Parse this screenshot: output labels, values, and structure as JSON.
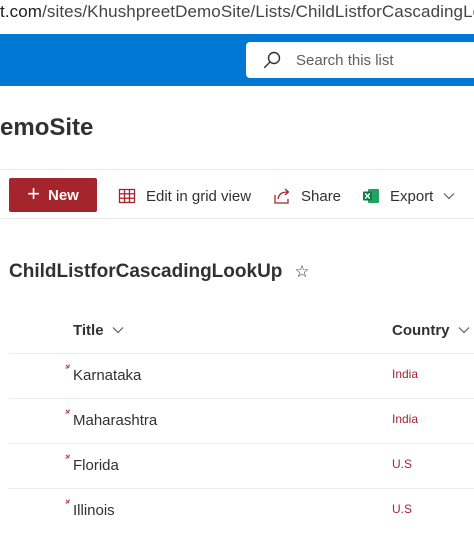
{
  "browser": {
    "url_domain": "t.com",
    "url_path": "/sites/KhushpreetDemoSite/Lists/ChildListforCascadingLookUp/AllI"
  },
  "suite_bar": {
    "search_placeholder": "Search this list"
  },
  "site": {
    "title": "emoSite"
  },
  "command_bar": {
    "new_label": "New",
    "grid_label": "Edit in grid view",
    "share_label": "Share",
    "export_label": "Export"
  },
  "list": {
    "title": "ChildListforCascadingLookUp",
    "columns": {
      "title": "Title",
      "country": "Country"
    },
    "rows": [
      {
        "title": "Karnataka",
        "country": "India"
      },
      {
        "title": "Maharashtra",
        "country": "India"
      },
      {
        "title": "Florida",
        "country": "U.S"
      },
      {
        "title": "Illinois",
        "country": "U.S"
      }
    ]
  },
  "colors": {
    "suite_bar": "#0078d4",
    "new_button": "#a4262c",
    "country_text": "#a4262c",
    "excel_icon": "#107c41"
  },
  "icons": [
    "search-icon",
    "plus-icon",
    "grid-icon",
    "share-icon",
    "excel-icon",
    "chevron-down-icon",
    "star-icon",
    "new-item-icon"
  ]
}
